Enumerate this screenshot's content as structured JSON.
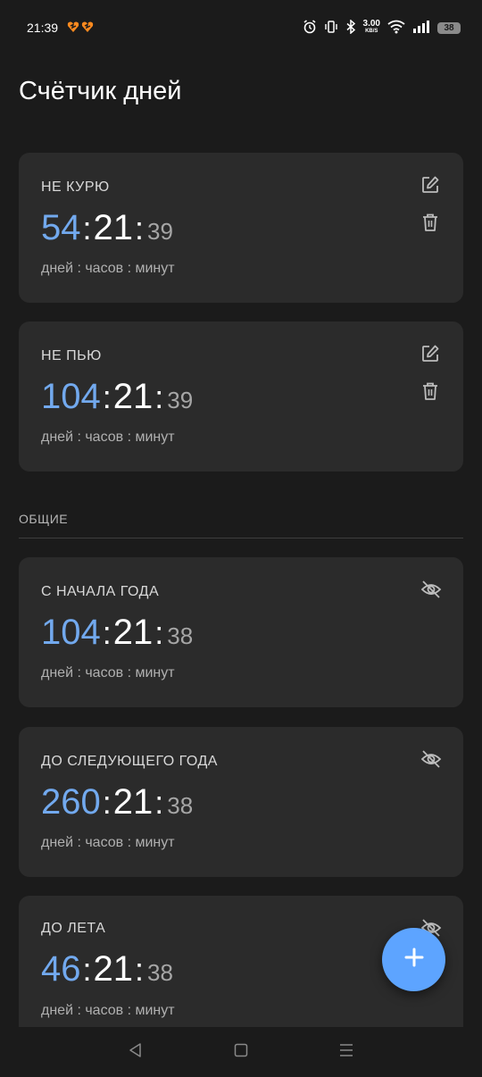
{
  "status_bar": {
    "time": "21:39",
    "net_speed_value": "3.00",
    "net_speed_unit": "KB/S",
    "battery": "38",
    "icons": [
      "heart-notification-icon",
      "alarm-icon",
      "vibrate-icon",
      "bluetooth-icon",
      "wifi-icon",
      "signal-icon",
      "battery-icon"
    ]
  },
  "app": {
    "title": "Счётчик дней"
  },
  "colors": {
    "days": "#72a9ee",
    "accent_fab": "#5da4ff",
    "card": "#2b2b2b",
    "background": "#1b1b1b"
  },
  "cards": [
    {
      "title": "НЕ КУРЮ",
      "days": "54",
      "hours": "21",
      "minutes": "39",
      "units": "дней : часов : минут",
      "actions": [
        "edit-icon",
        "delete-icon"
      ]
    },
    {
      "title": "НЕ ПЬЮ",
      "days": "104",
      "hours": "21",
      "minutes": "39",
      "units": "дней : часов : минут",
      "actions": [
        "edit-icon",
        "delete-icon"
      ]
    }
  ],
  "section": {
    "label": "ОБЩИЕ"
  },
  "common_cards": [
    {
      "title": "С НАЧАЛА ГОДА",
      "days": "104",
      "hours": "21",
      "minutes": "38",
      "units": "дней : часов : минут",
      "actions": [
        "hide-icon"
      ]
    },
    {
      "title": "ДО СЛЕДУЮЩЕГО ГОДА",
      "days": "260",
      "hours": "21",
      "minutes": "38",
      "units": "дней : часов : минут",
      "actions": [
        "hide-icon"
      ]
    },
    {
      "title": "ДО ЛЕТА",
      "days": "46",
      "hours": "21",
      "minutes": "38",
      "units": "дней : часов : минут",
      "actions": [
        "hide-icon"
      ]
    }
  ],
  "separator": ":",
  "fab": {
    "icon": "plus-icon"
  },
  "nav_bar": {
    "icons": [
      "back-icon",
      "home-icon",
      "recents-icon"
    ]
  }
}
